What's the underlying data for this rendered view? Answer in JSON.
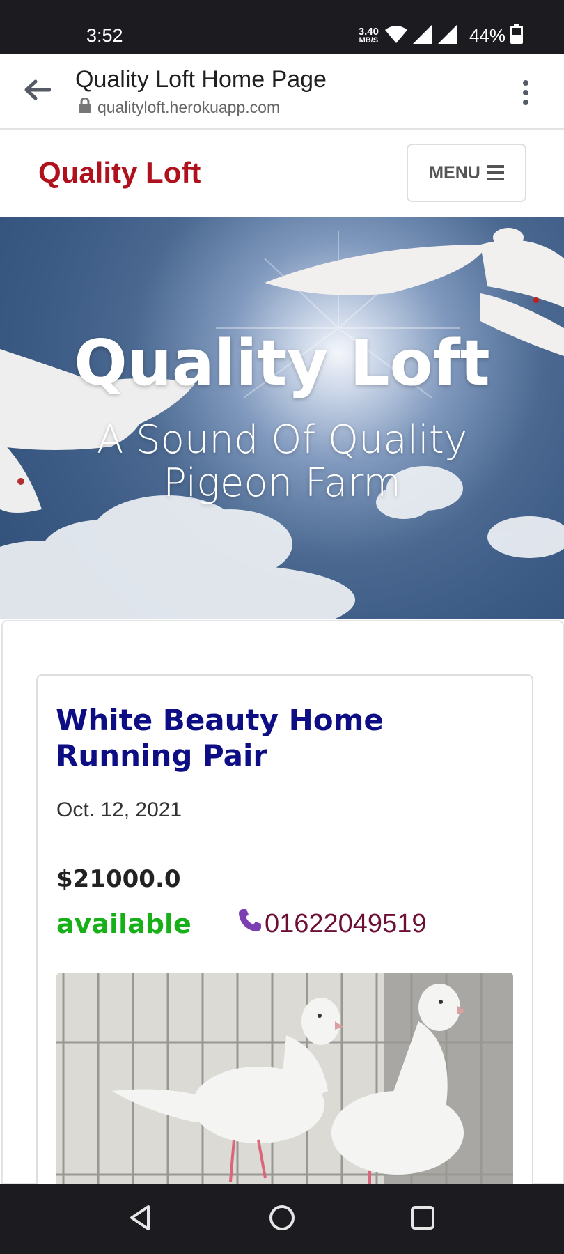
{
  "status_bar": {
    "time": "3:52",
    "net_speed_value": "3.40",
    "net_speed_unit": "MB/S",
    "battery_percent": "44%"
  },
  "browser": {
    "page_title": "Quality Loft Home Page",
    "url": "qualityloft.herokuapp.com"
  },
  "navbar": {
    "brand": "Quality Loft",
    "menu_label": "MENU"
  },
  "hero": {
    "title": "Quality Loft",
    "subtitle": "A Sound Of Quality Pigeon Farm"
  },
  "post": {
    "title": "White Beauty Home Running Pair",
    "date": "Oct. 12, 2021",
    "price": "$21000.0",
    "status": "available",
    "phone": "01622049519"
  },
  "colors": {
    "brand_red": "#b0121d",
    "post_title_navy": "#0d0d84",
    "available_green": "#18b018",
    "phone_maroon": "#6c0e35",
    "phone_icon_purple": "#7a3fb3"
  },
  "icons": {
    "back": "arrow-left-icon",
    "lock": "lock-icon",
    "overflow": "kebab-menu-icon",
    "menu": "hamburger-icon",
    "phone": "phone-icon"
  }
}
